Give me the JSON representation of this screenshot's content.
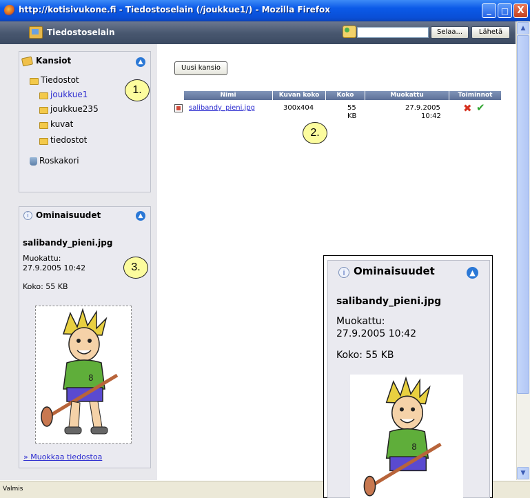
{
  "window": {
    "title": "http://kotisivukone.fi - Tiedostoselain (/joukkue1/) - Mozilla Firefox",
    "minimize": "_",
    "maximize": "□",
    "close": "X"
  },
  "app": {
    "title": "Tiedostoselain",
    "browse_label": "Selaa...",
    "send_label": "Lähetä",
    "file_input_value": ""
  },
  "folders": {
    "title": "Kansiot",
    "root": "Tiedostot",
    "items": [
      "joukkue1",
      "joukkue235",
      "kuvat",
      "tiedostot"
    ],
    "selected": "joukkue1",
    "trash": "Roskakori"
  },
  "properties": {
    "title": "Ominaisuudet",
    "filename": "salibandy_pieni.jpg",
    "modified_label": "Muokattu:",
    "modified_value": "27.9.2005 10:42",
    "size_text": "Koko: 55 KB",
    "edit_link": "» Muokkaa tiedostoa"
  },
  "main": {
    "new_folder_label": "Uusi kansio",
    "columns": [
      "Nimi",
      "Kuvan koko",
      "Koko",
      "Muokattu",
      "Toiminnot"
    ],
    "rows": [
      {
        "name": "salibandy_pieni.jpg",
        "dims": "300x404",
        "size_num": "55",
        "size_unit": "KB",
        "date": "27.9.2005",
        "time": "10:42"
      }
    ]
  },
  "callouts": [
    "1.",
    "2.",
    "3."
  ],
  "status": "Valmis",
  "colors": {
    "titlebar": "#0b5ae8",
    "appbar": "#495870",
    "link": "#2b2bcf",
    "callout": "#fcfc9e",
    "table_header": "#6b7ea6"
  }
}
